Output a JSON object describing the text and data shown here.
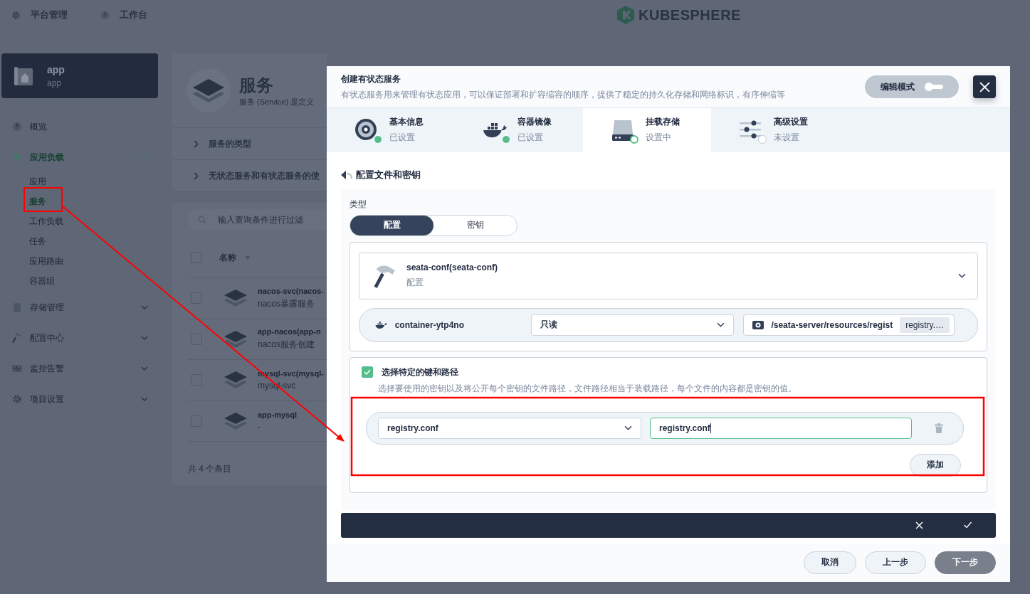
{
  "topbar": {
    "items": [
      {
        "label": "平台管理"
      },
      {
        "label": "工作台"
      }
    ],
    "logo": "KUBESPHERE"
  },
  "project": {
    "name": "app",
    "subtitle": "app"
  },
  "nav": [
    {
      "label": "概览",
      "selected": false
    },
    {
      "label": "应用负载",
      "selected": true,
      "expanded": true,
      "children": [
        {
          "label": "应用",
          "selected": false
        },
        {
          "label": "服务",
          "selected": true
        },
        {
          "label": "工作负载",
          "selected": false
        },
        {
          "label": "任务",
          "selected": false
        },
        {
          "label": "应用路由",
          "selected": false
        },
        {
          "label": "容器组",
          "selected": false
        }
      ]
    },
    {
      "label": "存储管理",
      "selected": false,
      "expanded": false
    },
    {
      "label": "配置中心",
      "selected": false,
      "expanded": false
    },
    {
      "label": "监控告警",
      "selected": false,
      "expanded": false
    },
    {
      "label": "项目设置",
      "selected": false,
      "expanded": false
    }
  ],
  "page": {
    "title": "服务",
    "description": "服务 (Service) 是定义",
    "sections": [
      "服务的类型",
      "无状态服务和有状态服务的使"
    ],
    "search": {
      "placeholder": "输入查询条件进行过滤"
    },
    "table": {
      "select_all": false,
      "columns": [
        "名称"
      ],
      "rows": [
        {
          "checked": false,
          "name": "nacos-svc(nacos-",
          "description": "nacos暴露服务"
        },
        {
          "checked": false,
          "name": "app-nacos(app-n",
          "description": "nacos服务创建"
        },
        {
          "checked": false,
          "name": "mysql-svc(mysql-",
          "description": "mysql-svc"
        },
        {
          "checked": false,
          "name": "app-mysql",
          "description": "-"
        }
      ],
      "footer": "共 4 个条目"
    }
  },
  "dialog": {
    "title": "创建有状态服务",
    "description": "有状态服务用来管理有状态应用，可以保证部署和扩容缩容的顺序，提供了稳定的持久化存储和网络标识，有序伸缩等",
    "edit_mode": {
      "label": "编辑模式",
      "on": false
    },
    "steps": [
      {
        "title": "基本信息",
        "status": "已设置",
        "completed": true,
        "selected": false
      },
      {
        "title": "容器镜像",
        "status": "已设置",
        "completed": true,
        "selected": false
      },
      {
        "title": "挂载存储",
        "status": "设置中",
        "completed": false,
        "selected": true
      },
      {
        "title": "高级设置",
        "status": "未设置",
        "completed": false,
        "selected": false
      }
    ],
    "section_title": "配置文件和密钥",
    "type_label": "类型",
    "type_options": [
      {
        "label": "配置",
        "selected": true
      },
      {
        "label": "密钥",
        "selected": false
      }
    ],
    "resource": {
      "name": "seata-conf(seata-conf)",
      "type": "配置"
    },
    "mount": {
      "container": "container-ytp4no",
      "mode": "只读",
      "path": "/seata-server/resources/regist",
      "path_tag": "registry.…"
    },
    "specific_keys": {
      "checked": true,
      "label": "选择特定的键和路径",
      "description": "选择要使用的密钥以及将公开每个密钥的文件路径，文件路径相当于装载路径，每个文件的内容都是密钥的值。",
      "items": [
        {
          "key": "registry.conf",
          "path": "registry.conf"
        }
      ],
      "add_button": "添加"
    },
    "buttons": [
      {
        "label": "取消",
        "kind": "secondary"
      },
      {
        "label": "上一步",
        "kind": "secondary"
      },
      {
        "label": "下一步",
        "kind": "primary"
      }
    ]
  }
}
